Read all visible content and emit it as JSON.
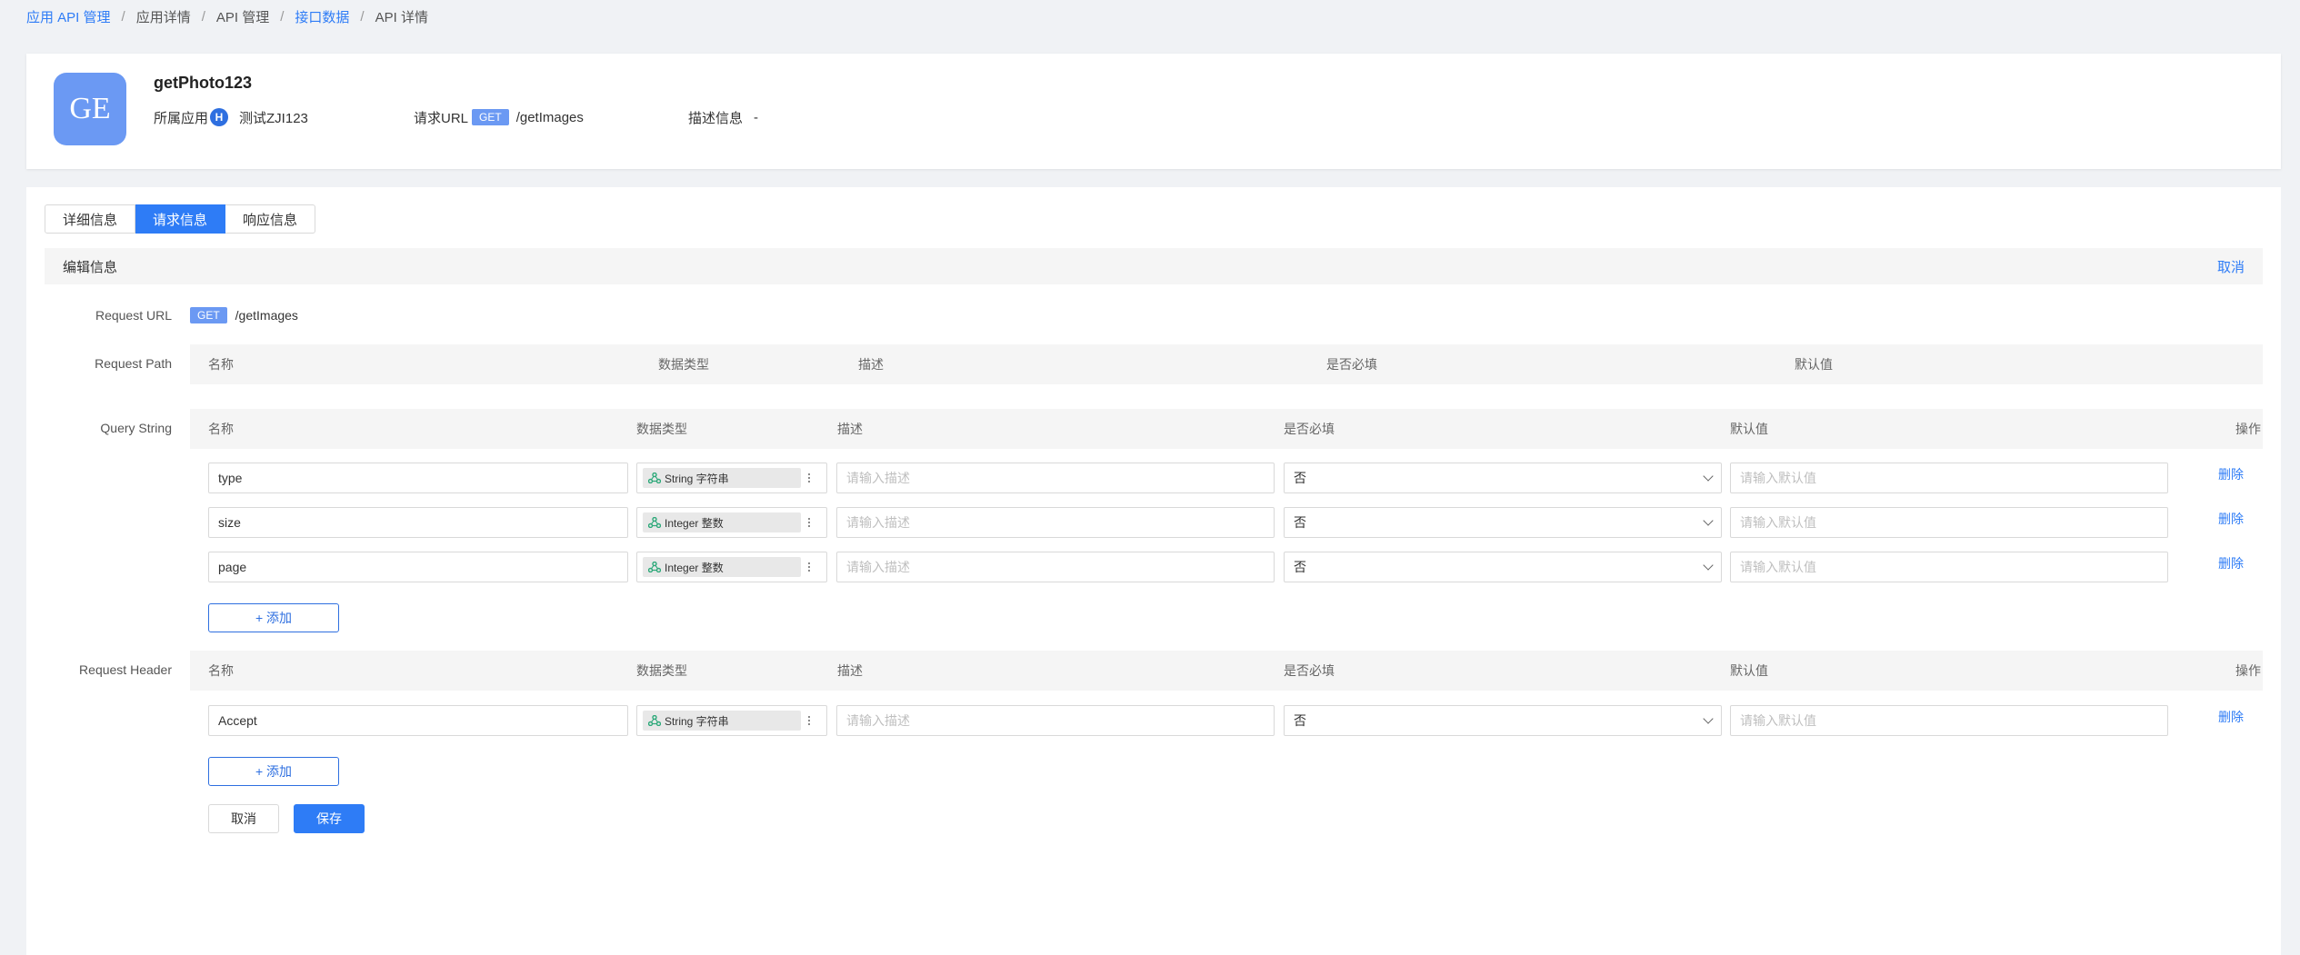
{
  "breadcrumb": [
    {
      "label": "应用 API 管理",
      "link": true
    },
    {
      "label": "应用详情",
      "link": false
    },
    {
      "label": "API 管理",
      "link": false
    },
    {
      "label": "接口数据",
      "link": true
    },
    {
      "label": "API 详情",
      "link": false
    }
  ],
  "header": {
    "logo_text": "GE",
    "api_name": "getPhoto123",
    "app_label": "所属应用",
    "app_badge": "H",
    "app_name": "测试ZJI123",
    "url_label": "请求URL",
    "method": "GET",
    "path": "/getImages",
    "desc_label": "描述信息",
    "desc_value": "-"
  },
  "tabs": [
    "详细信息",
    "请求信息",
    "响应信息"
  ],
  "active_tab": 1,
  "section": {
    "title": "编辑信息",
    "cancel": "取消"
  },
  "request_url": {
    "label": "Request URL",
    "method": "GET",
    "path": "/getImages"
  },
  "request_path": {
    "label": "Request Path",
    "columns": {
      "name": "名称",
      "type": "数据类型",
      "desc": "描述",
      "required": "是否必填",
      "default": "默认值"
    }
  },
  "query_string": {
    "label": "Query String",
    "columns": {
      "name": "名称",
      "type": "数据类型",
      "desc": "描述",
      "required": "是否必填",
      "default": "默认值",
      "action": "操作"
    },
    "rows": [
      {
        "name": "type",
        "type": "String 字符串",
        "desc_placeholder": "请输入描述",
        "required": "否",
        "default_placeholder": "请输入默认值",
        "action": "删除"
      },
      {
        "name": "size",
        "type": "Integer 整数",
        "desc_placeholder": "请输入描述",
        "required": "否",
        "default_placeholder": "请输入默认值",
        "action": "删除"
      },
      {
        "name": "page",
        "type": "Integer 整数",
        "desc_placeholder": "请输入描述",
        "required": "否",
        "default_placeholder": "请输入默认值",
        "action": "删除"
      }
    ],
    "add_label": "+ 添加"
  },
  "request_header": {
    "label": "Request Header",
    "columns": {
      "name": "名称",
      "type": "数据类型",
      "desc": "描述",
      "required": "是否必填",
      "default": "默认值",
      "action": "操作"
    },
    "rows": [
      {
        "name": "Accept",
        "type": "String 字符串",
        "desc_placeholder": "请输入描述",
        "required": "否",
        "default_placeholder": "请输入默认值",
        "action": "删除"
      }
    ],
    "add_label": "+ 添加"
  },
  "footer": {
    "cancel": "取消",
    "save": "保存"
  }
}
